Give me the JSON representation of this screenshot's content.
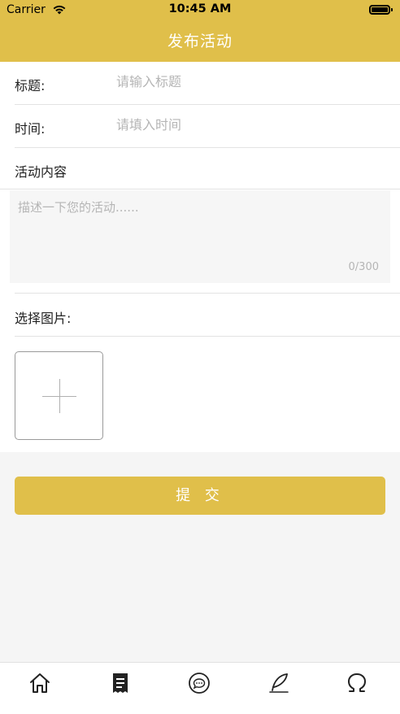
{
  "status_bar": {
    "carrier": "Carrier",
    "time": "10:45 AM"
  },
  "header": {
    "title": "发布活动",
    "color": "#e0bf4a"
  },
  "form": {
    "title_label": "标题:",
    "title_placeholder": "请输入标题",
    "time_label": "时间:",
    "time_placeholder": "请填入时间",
    "content_label": "活动内容",
    "content_placeholder": "描述一下您的活动......",
    "char_counter": "0/300",
    "image_label": "选择图片:"
  },
  "submit_label": "提 交",
  "tabbar": {
    "items": [
      {
        "icon": "home-icon"
      },
      {
        "icon": "document-icon"
      },
      {
        "icon": "chat-icon"
      },
      {
        "icon": "quill-icon"
      },
      {
        "icon": "omega-icon"
      }
    ]
  }
}
